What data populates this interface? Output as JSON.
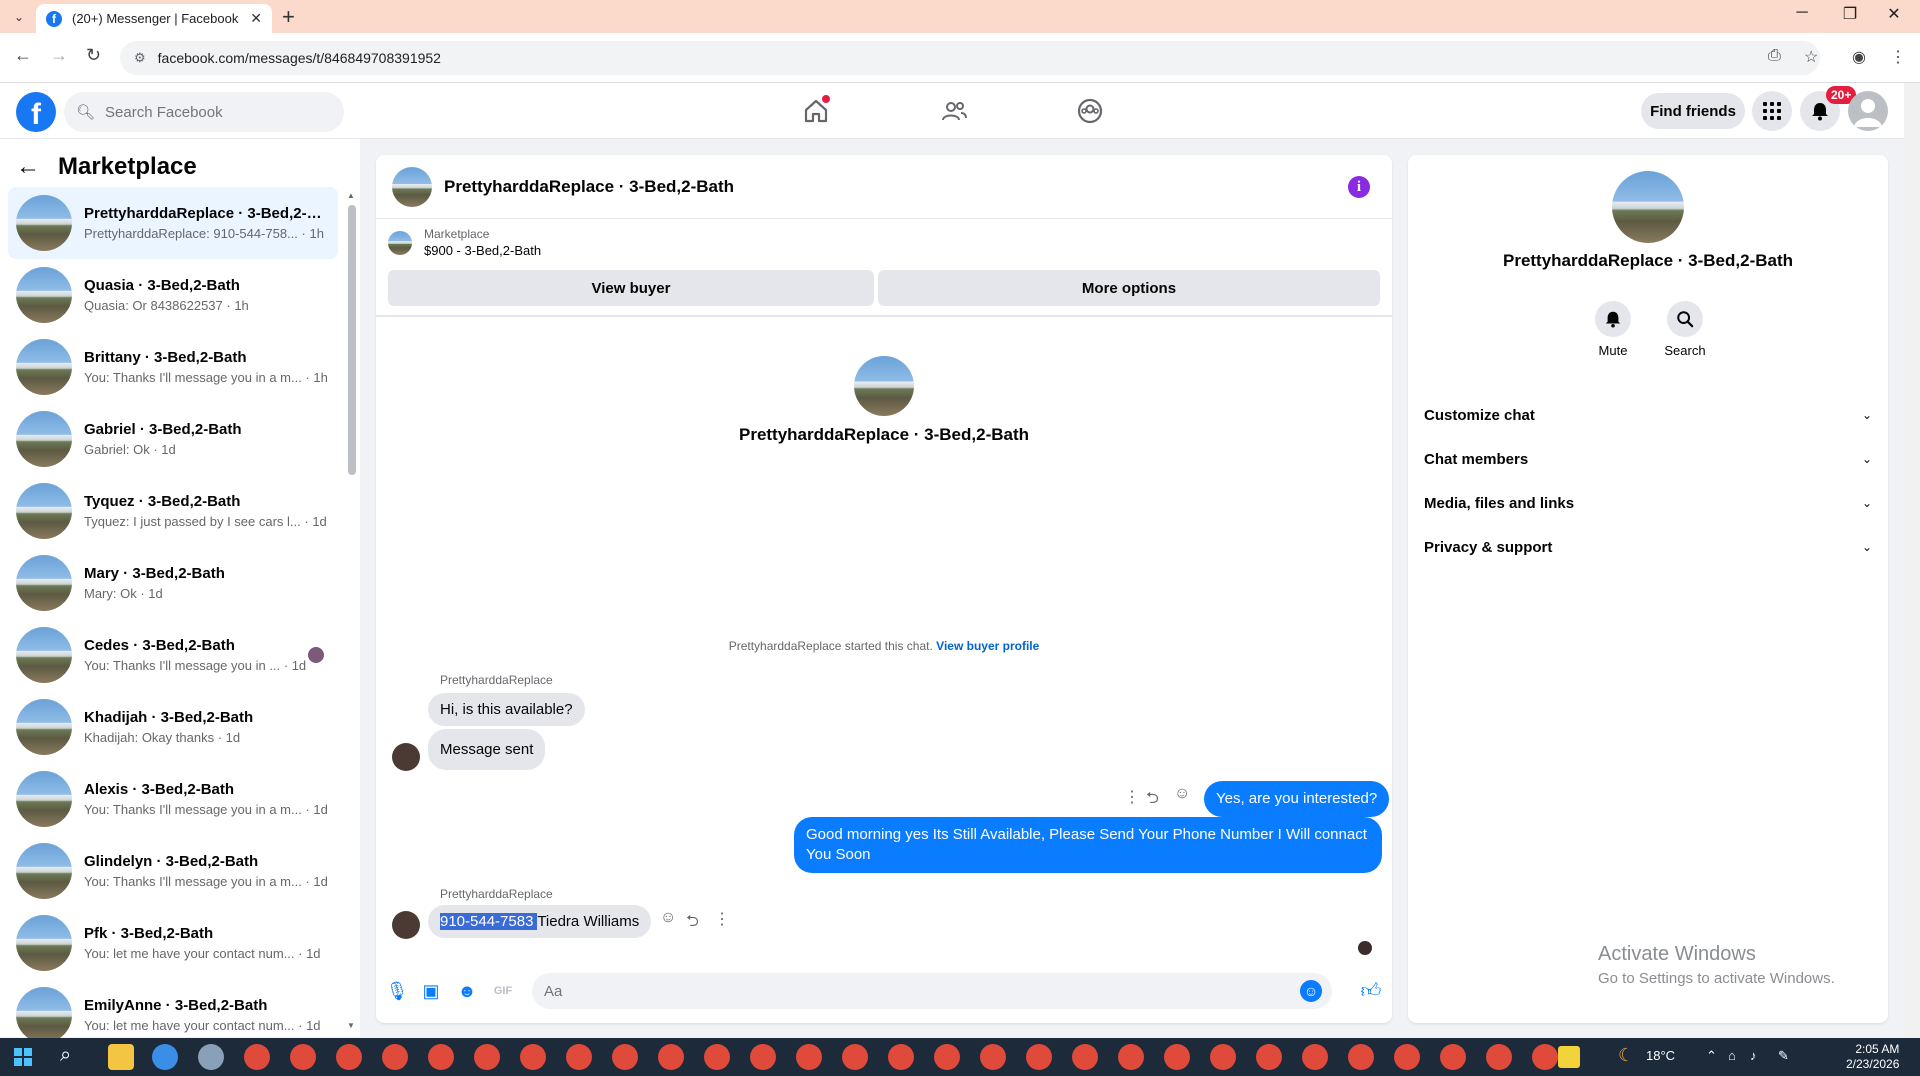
{
  "browser": {
    "tab_title": "(20+) Messenger | Facebook",
    "url": "facebook.com/messages/t/846849708391952"
  },
  "fb": {
    "search_placeholder": "Search Facebook",
    "find_friends": "Find friends",
    "notif_badge": "20+"
  },
  "left": {
    "title": "Marketplace",
    "conversations": [
      {
        "name": "PrettyharddaReplace · 3-Bed,2-B...",
        "preview": "PrettyharddaReplace: 910-544-758... · 1h",
        "active": true
      },
      {
        "name": "Quasia · 3-Bed,2-Bath",
        "preview": "Quasia: Or 8438622537 · 1h"
      },
      {
        "name": "Brittany · 3-Bed,2-Bath",
        "preview": "You: Thanks I'll message you in a m... · 1h"
      },
      {
        "name": "Gabriel · 3-Bed,2-Bath",
        "preview": "Gabriel: Ok · 1d"
      },
      {
        "name": "Tyquez · 3-Bed,2-Bath",
        "preview": "Tyquez: I just passed by I see cars l... · 1d"
      },
      {
        "name": "Mary · 3-Bed,2-Bath",
        "preview": "Mary: Ok · 1d"
      },
      {
        "name": "Cedes · 3-Bed,2-Bath",
        "preview": "You: Thanks I'll message you in ... · 1d"
      },
      {
        "name": "Khadijah · 3-Bed,2-Bath",
        "preview": "Khadijah: Okay thanks · 1d"
      },
      {
        "name": "Alexis · 3-Bed,2-Bath",
        "preview": "You: Thanks I'll message you in a m... · 1d"
      },
      {
        "name": "Glindelyn · 3-Bed,2-Bath",
        "preview": "You: Thanks I'll message you in a m... · 1d"
      },
      {
        "name": "Pfk · 3-Bed,2-Bath",
        "preview": "You: let me have your contact num... · 1d"
      },
      {
        "name": "EmilyAnne · 3-Bed,2-Bath",
        "preview": "You: let me have your contact num... · 1d"
      }
    ]
  },
  "chat": {
    "header_name": "PrettyharddaReplace · 3-Bed,2-Bath",
    "marketplace_label": "Marketplace",
    "listing": "$900 - 3-Bed,2-Bath",
    "view_buyer": "View buyer",
    "more_options": "More options",
    "center_name": "PrettyharddaReplace · 3-Bed,2-Bath",
    "started_text": "PrettyharddaReplace started this chat.",
    "view_buyer_profile": "View buyer profile",
    "sender_name": "PrettyharddaReplace",
    "msg1": "Hi, is this available?",
    "msg2": "Message sent",
    "out1": "Yes, are you interested?",
    "out2": "Good morning yes  Its Still Available, Please Send Your Phone Number I Will connact You Soon",
    "sender_name_2": "PrettyharddaReplace",
    "msg3_highlight": "910-544-7583 ",
    "msg3_rest": "Tiedra Williams",
    "composer_placeholder": "Aa"
  },
  "right": {
    "name": "PrettyharddaReplace · 3-Bed,2-Bath",
    "mute": "Mute",
    "search": "Search",
    "sections": [
      "Customize chat",
      "Chat members",
      "Media, files and links",
      "Privacy & support"
    ],
    "watermark_1": "Activate Windows",
    "watermark_2": "Go to Settings to activate Windows."
  },
  "taskbar": {
    "temp": "18°C",
    "time": "2:05 AM",
    "date": "2/23/2026"
  },
  "colors": {
    "fb_blue": "#1877f2",
    "messenger_blue": "#0a7cff",
    "tab_bar": "#fbd9cb"
  }
}
